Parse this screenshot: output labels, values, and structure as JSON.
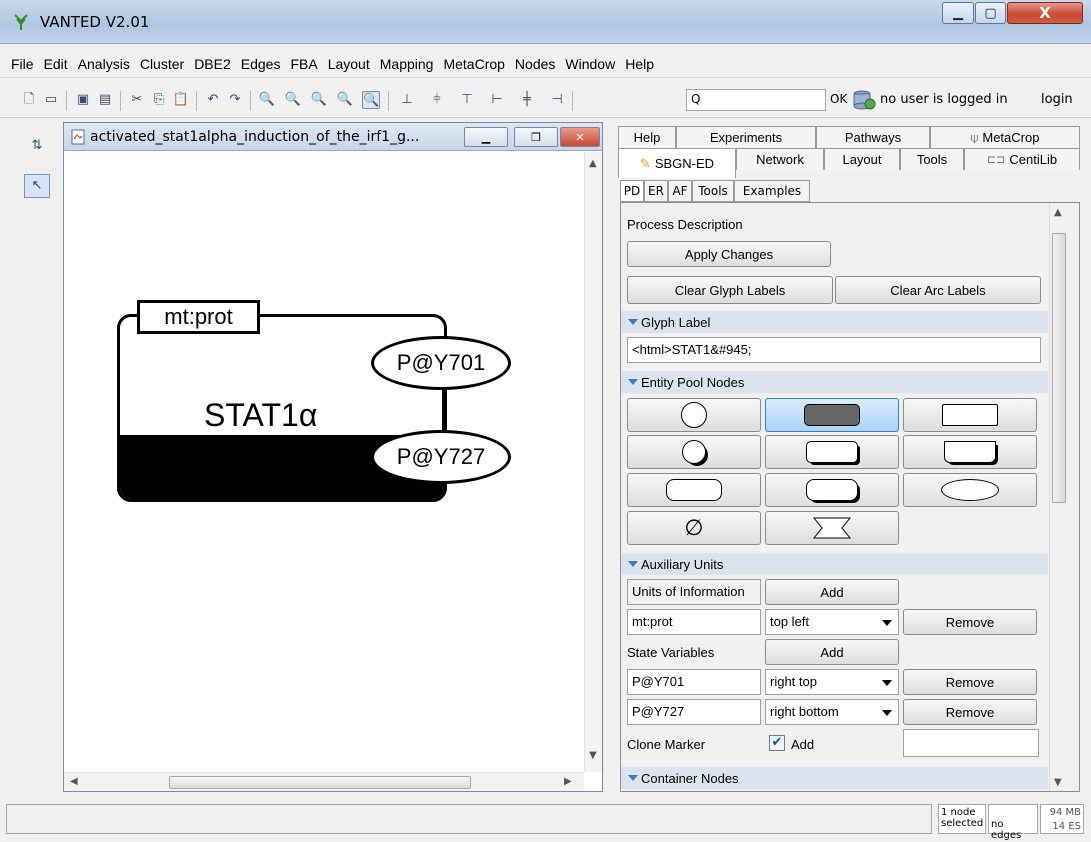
{
  "window": {
    "title": "VANTED V2.01",
    "close_glyph": "X"
  },
  "menu": [
    "File",
    "Edit",
    "Analysis",
    "Cluster",
    "DBE2",
    "Edges",
    "FBA",
    "Layout",
    "Mapping",
    "MetaCrop",
    "Nodes",
    "Window",
    "Help"
  ],
  "toolbar": {
    "search_value": "Q",
    "ok_label": "OK",
    "login_status": "no user is logged in",
    "login_link": "login"
  },
  "graph_window": {
    "title": "activated_stat1alpha_induction_of_the_irf1_g..."
  },
  "glyph": {
    "label": "STAT1α",
    "unit_of_information": "mt:prot",
    "state_var_top": "P@Y701",
    "state_var_bottom": "P@Y727"
  },
  "panel": {
    "tabs_row1": [
      "Help",
      "Experiments",
      "Pathways",
      "MetaCrop"
    ],
    "tabs_row2": [
      "SBGN-ED",
      "Network",
      "Layout",
      "Tools",
      "CentiLib"
    ],
    "subtabs": [
      "PD",
      "ER",
      "AF",
      "Tools",
      "Examples"
    ],
    "pd_title": "Process Description",
    "apply_changes": "Apply Changes",
    "clear_glyph_labels": "Clear Glyph Labels",
    "clear_arc_labels": "Clear Arc Labels",
    "glyph_label_header": "Glyph Label",
    "glyph_label_value": "<html>STAT1&#945;",
    "entity_pool_header": "Entity Pool Nodes",
    "auxiliary_header": "Auxiliary Units",
    "units_of_info_label": "Units of Information",
    "add_label": "Add",
    "remove_label": "Remove",
    "unit_row": {
      "value": "mt:prot",
      "position": "top left"
    },
    "state_variables_label": "State Variables",
    "state_rows": [
      {
        "value": "P@Y701",
        "position": "right top"
      },
      {
        "value": "P@Y727",
        "position": "right bottom"
      }
    ],
    "clone_marker_label": "Clone Marker",
    "clone_add_label": "Add",
    "clone_checked": true,
    "container_header": "Container Nodes"
  },
  "statusbar": {
    "selection": "1 node selected",
    "edges": "no edges",
    "memory": "94 MB",
    "es": "14 ES"
  }
}
